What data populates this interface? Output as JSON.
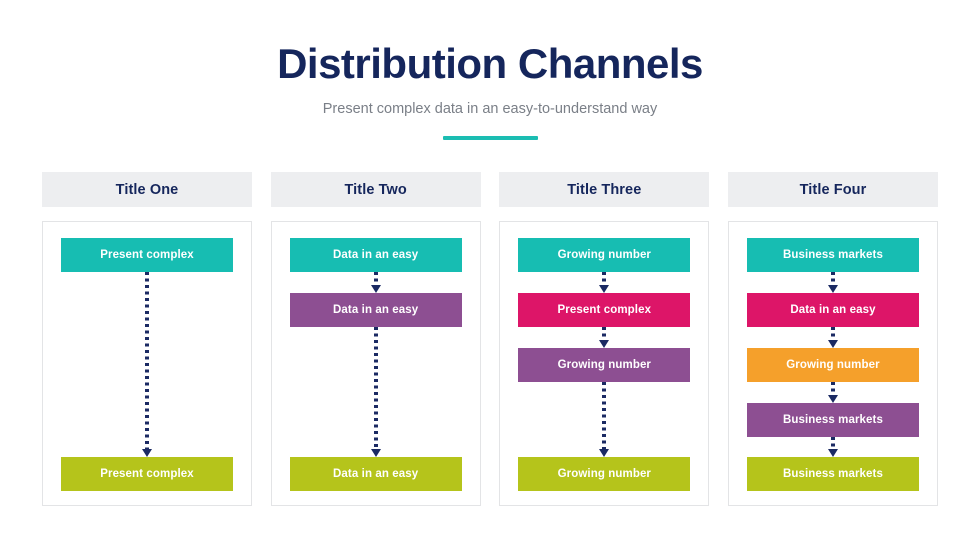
{
  "header": {
    "title": "Distribution Channels",
    "subtitle": "Present complex data in an easy-to-understand way",
    "accent_color": "#1bbdb2",
    "title_color": "#15265c",
    "subtitle_color": "#7a7f87"
  },
  "palette": {
    "teal": "#17bdb2",
    "pink": "#dd1568",
    "orange": "#f5a02b",
    "purple": "#8d4f92",
    "olive": "#b5c41b",
    "header_bar": "#edeef0",
    "navy": "#15265c",
    "connector": "#1b2a63",
    "card_border": "#e3e4e6"
  },
  "columns": [
    {
      "header": "Title One",
      "nodes": [
        {
          "label": "Present complex",
          "color": "#17bdb2"
        },
        {
          "label": "Present complex",
          "color": "#b5c41b"
        }
      ]
    },
    {
      "header": "Title Two",
      "nodes": [
        {
          "label": "Data in an easy",
          "color": "#17bdb2"
        },
        {
          "label": "Data in an easy",
          "color": "#8d4f92"
        },
        {
          "label": "Data in an easy",
          "color": "#b5c41b"
        }
      ]
    },
    {
      "header": "Title Three",
      "nodes": [
        {
          "label": "Growing number",
          "color": "#17bdb2"
        },
        {
          "label": "Present complex",
          "color": "#dd1568"
        },
        {
          "label": "Growing number",
          "color": "#8d4f92"
        },
        {
          "label": "Growing number",
          "color": "#b5c41b"
        }
      ]
    },
    {
      "header": "Title Four",
      "nodes": [
        {
          "label": "Business markets",
          "color": "#17bdb2"
        },
        {
          "label": "Data in an easy",
          "color": "#dd1568"
        },
        {
          "label": "Growing number",
          "color": "#f5a02b"
        },
        {
          "label": "Business markets",
          "color": "#8d4f92"
        },
        {
          "label": "Business markets",
          "color": "#b5c41b"
        }
      ]
    }
  ]
}
